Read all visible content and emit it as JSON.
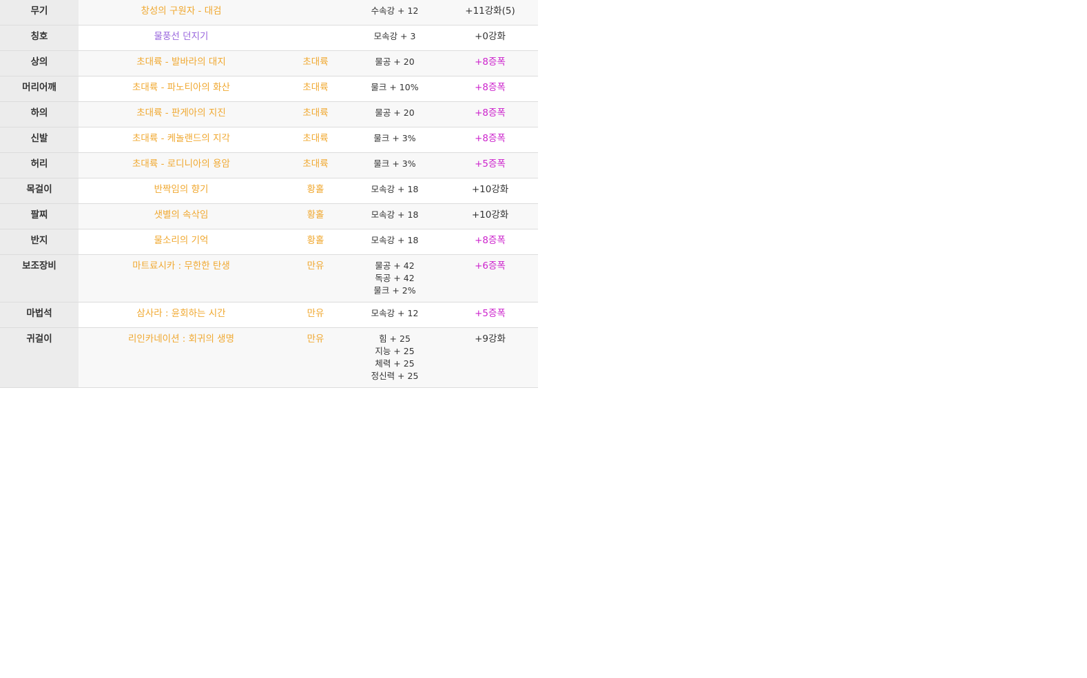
{
  "colors": {
    "epic_orange": "#f0a830",
    "legendary_purple": "#9966dd",
    "amp_magenta": "#cc22cc",
    "normal_text": "#333333"
  },
  "rows": [
    {
      "slot": "무기",
      "name": "창성의 구원자 - 대검",
      "name_color": "#f0a830",
      "set": "",
      "stats": [
        "수속강 + 12"
      ],
      "upgrade": "+11강화(5)",
      "upgrade_color": "#333333"
    },
    {
      "slot": "칭호",
      "name": "물풍선 던지기",
      "name_color": "#9966dd",
      "set": "",
      "stats": [
        "모속강 + 3"
      ],
      "upgrade": "+0강화",
      "upgrade_color": "#333333"
    },
    {
      "slot": "상의",
      "name": "초대륙 - 발바라의 대지",
      "name_color": "#f0a830",
      "set": "초대륙",
      "stats": [
        "물공 + 20"
      ],
      "upgrade": "+8증폭",
      "upgrade_color": "#cc22cc"
    },
    {
      "slot": "머리어깨",
      "name": "초대륙 - 파노티아의 화산",
      "name_color": "#f0a830",
      "set": "초대륙",
      "stats": [
        "물크 + 10%"
      ],
      "upgrade": "+8증폭",
      "upgrade_color": "#cc22cc"
    },
    {
      "slot": "하의",
      "name": "초대륙 - 판게아의 지진",
      "name_color": "#f0a830",
      "set": "초대륙",
      "stats": [
        "물공 + 20"
      ],
      "upgrade": "+8증폭",
      "upgrade_color": "#cc22cc"
    },
    {
      "slot": "신발",
      "name": "초대륙 - 케놀랜드의 지각",
      "name_color": "#f0a830",
      "set": "초대륙",
      "stats": [
        "물크 + 3%"
      ],
      "upgrade": "+8증폭",
      "upgrade_color": "#cc22cc"
    },
    {
      "slot": "허리",
      "name": "초대륙 - 로디니아의 용암",
      "name_color": "#f0a830",
      "set": "초대륙",
      "stats": [
        "물크 + 3%"
      ],
      "upgrade": "+5증폭",
      "upgrade_color": "#cc22cc"
    },
    {
      "slot": "목걸이",
      "name": "반짝임의 향기",
      "name_color": "#f0a830",
      "set": "황홀",
      "stats": [
        "모속강 + 18"
      ],
      "upgrade": "+10강화",
      "upgrade_color": "#333333"
    },
    {
      "slot": "팔찌",
      "name": "샛별의 속삭임",
      "name_color": "#f0a830",
      "set": "황홀",
      "stats": [
        "모속강 + 18"
      ],
      "upgrade": "+10강화",
      "upgrade_color": "#333333"
    },
    {
      "slot": "반지",
      "name": "물소리의 기억",
      "name_color": "#f0a830",
      "set": "황홀",
      "stats": [
        "모속강 + 18"
      ],
      "upgrade": "+8증폭",
      "upgrade_color": "#cc22cc"
    },
    {
      "slot": "보조장비",
      "name": "마트료시카 : 무한한 탄생",
      "name_color": "#f0a830",
      "set": "만유",
      "stats": [
        "물공 + 42",
        "독공 + 42",
        "물크 + 2%"
      ],
      "upgrade": "+6증폭",
      "upgrade_color": "#cc22cc"
    },
    {
      "slot": "마법석",
      "name": "삼사라 : 윤회하는 시간",
      "name_color": "#f0a830",
      "set": "만유",
      "stats": [
        "모속강 + 12"
      ],
      "upgrade": "+5증폭",
      "upgrade_color": "#cc22cc"
    },
    {
      "slot": "귀걸이",
      "name": "리인카네이션 : 회귀의 생명",
      "name_color": "#f0a830",
      "set": "만유",
      "stats": [
        "힘 + 25",
        "지능 + 25",
        "체력 + 25",
        "정신력 + 25"
      ],
      "upgrade": "+9강화",
      "upgrade_color": "#333333"
    }
  ]
}
